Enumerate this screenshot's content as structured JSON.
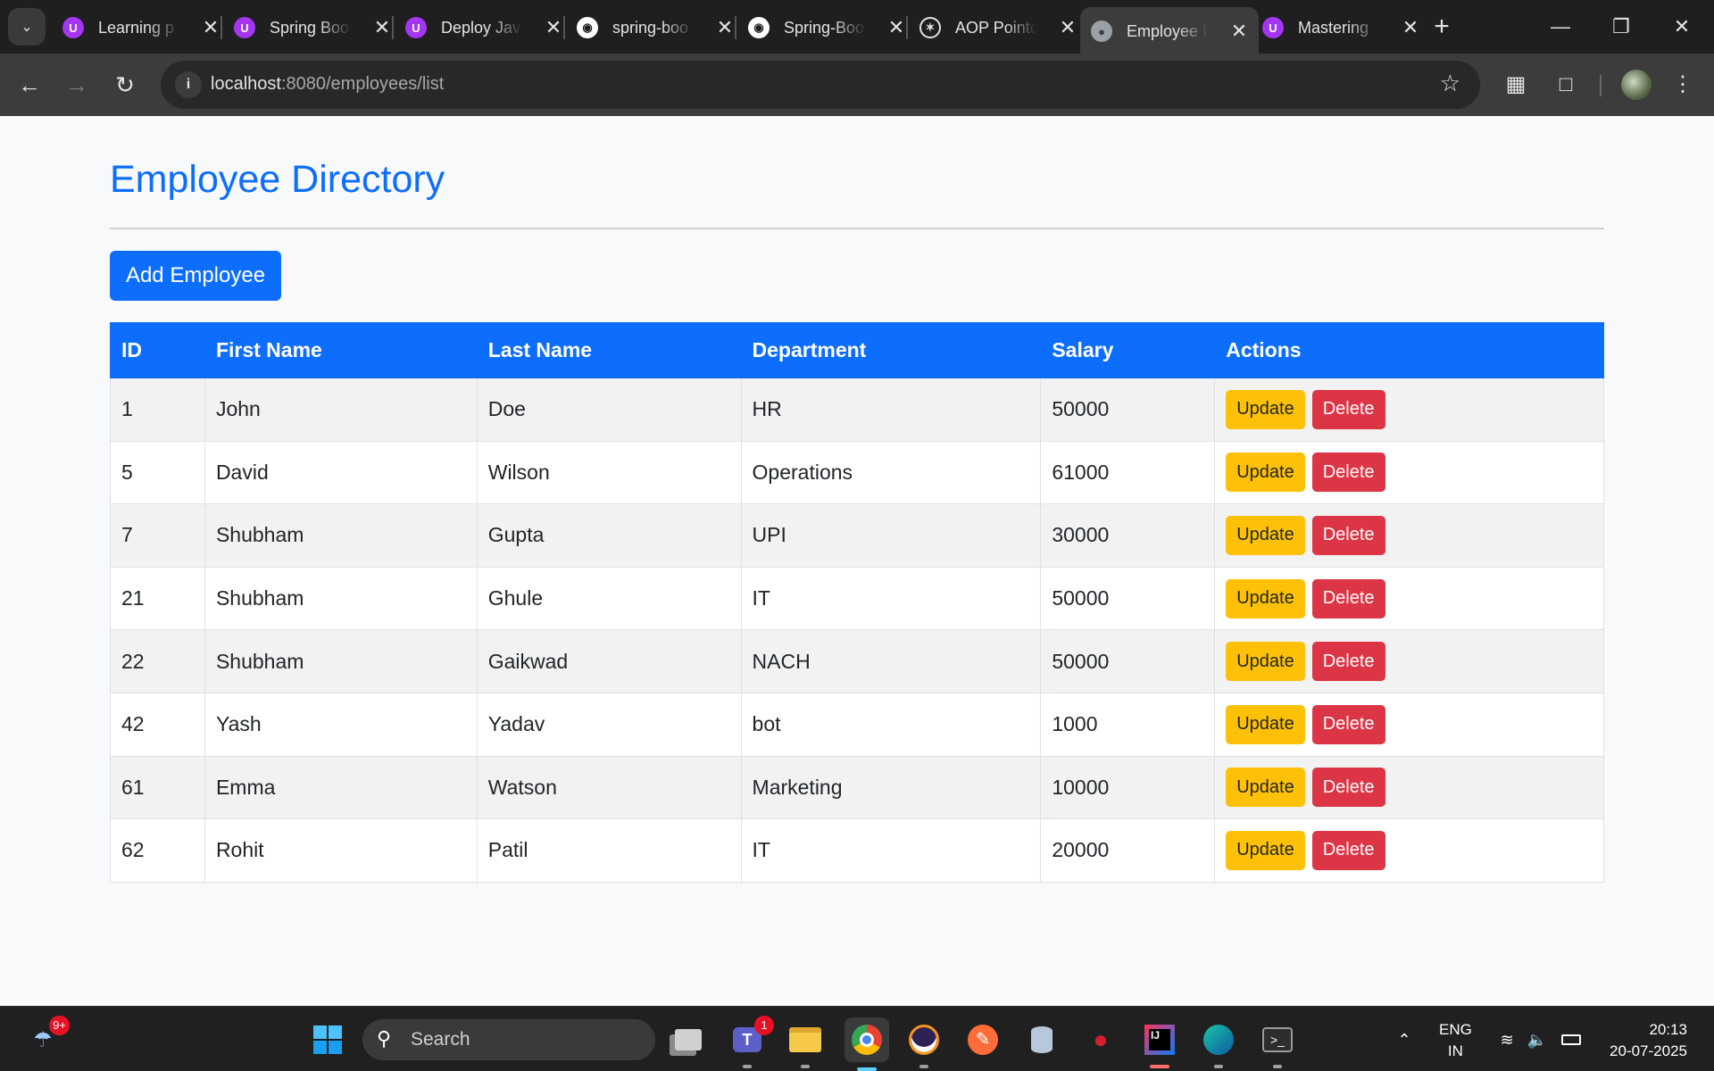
{
  "browser": {
    "tabs": [
      {
        "title": "Learning p",
        "icon": "udemy-icon"
      },
      {
        "title": "Spring Boo",
        "icon": "udemy-icon"
      },
      {
        "title": "Deploy Jav",
        "icon": "udemy-icon"
      },
      {
        "title": "spring-boo",
        "icon": "github-icon"
      },
      {
        "title": "Spring-Boo",
        "icon": "github-icon"
      },
      {
        "title": "AOP Pointc",
        "icon": "openai-icon"
      },
      {
        "title": "Employee I",
        "icon": "globe-icon"
      },
      {
        "title": "Mastering",
        "icon": "udemy-icon"
      }
    ],
    "url_host": "localhost",
    "url_path": ":8080/employees/list"
  },
  "page": {
    "title": "Employee Directory",
    "add_button": "Add Employee",
    "columns": [
      "ID",
      "First Name",
      "Last Name",
      "Department",
      "Salary",
      "Actions"
    ],
    "update_label": "Update",
    "delete_label": "Delete",
    "rows": [
      {
        "id": "1",
        "first": "John",
        "last": "Doe",
        "dept": "HR",
        "salary": "50000"
      },
      {
        "id": "5",
        "first": "David",
        "last": "Wilson",
        "dept": "Operations",
        "salary": "61000"
      },
      {
        "id": "7",
        "first": "Shubham",
        "last": "Gupta",
        "dept": "UPI",
        "salary": "30000"
      },
      {
        "id": "21",
        "first": "Shubham",
        "last": "Ghule",
        "dept": "IT",
        "salary": "50000"
      },
      {
        "id": "22",
        "first": "Shubham",
        "last": "Gaikwad",
        "dept": "NACH",
        "salary": "50000"
      },
      {
        "id": "42",
        "first": "Yash",
        "last": "Yadav",
        "dept": "bot",
        "salary": "1000"
      },
      {
        "id": "61",
        "first": "Emma",
        "last": "Watson",
        "dept": "Marketing",
        "salary": "10000"
      },
      {
        "id": "62",
        "first": "Rohit",
        "last": "Patil",
        "dept": "IT",
        "salary": "20000"
      }
    ]
  },
  "taskbar": {
    "widget_badge": "9+",
    "search_label": "Search",
    "teams_badge": "1",
    "lang_line1": "ENG",
    "lang_line2": "IN",
    "time": "20:13",
    "date": "20-07-2025"
  },
  "colors": {
    "primary": "#0d6efd",
    "warning": "#ffc107",
    "danger": "#dc3545"
  }
}
